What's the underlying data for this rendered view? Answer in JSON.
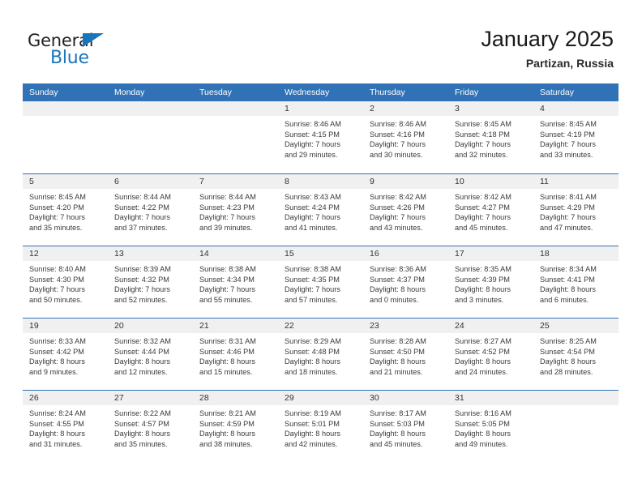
{
  "brand": {
    "name_dark": "General",
    "name_blue": "Blue",
    "triangle_icon": "triangle-icon",
    "accent_color": "#1b75bb"
  },
  "header": {
    "title": "January 2025",
    "subtitle": "Partizan, Russia"
  },
  "colors": {
    "header_blue": "#3072b5",
    "strip_gray": "#f0f0f0",
    "text": "#333333"
  },
  "calendar": {
    "weekday_headers": [
      "Sunday",
      "Monday",
      "Tuesday",
      "Wednesday",
      "Thursday",
      "Friday",
      "Saturday"
    ],
    "weeks": [
      [
        {
          "day": "",
          "lines": []
        },
        {
          "day": "",
          "lines": []
        },
        {
          "day": "",
          "lines": []
        },
        {
          "day": "1",
          "lines": [
            "Sunrise: 8:46 AM",
            "Sunset: 4:15 PM",
            "Daylight: 7 hours",
            "and 29 minutes."
          ]
        },
        {
          "day": "2",
          "lines": [
            "Sunrise: 8:46 AM",
            "Sunset: 4:16 PM",
            "Daylight: 7 hours",
            "and 30 minutes."
          ]
        },
        {
          "day": "3",
          "lines": [
            "Sunrise: 8:45 AM",
            "Sunset: 4:18 PM",
            "Daylight: 7 hours",
            "and 32 minutes."
          ]
        },
        {
          "day": "4",
          "lines": [
            "Sunrise: 8:45 AM",
            "Sunset: 4:19 PM",
            "Daylight: 7 hours",
            "and 33 minutes."
          ]
        }
      ],
      [
        {
          "day": "5",
          "lines": [
            "Sunrise: 8:45 AM",
            "Sunset: 4:20 PM",
            "Daylight: 7 hours",
            "and 35 minutes."
          ]
        },
        {
          "day": "6",
          "lines": [
            "Sunrise: 8:44 AM",
            "Sunset: 4:22 PM",
            "Daylight: 7 hours",
            "and 37 minutes."
          ]
        },
        {
          "day": "7",
          "lines": [
            "Sunrise: 8:44 AM",
            "Sunset: 4:23 PM",
            "Daylight: 7 hours",
            "and 39 minutes."
          ]
        },
        {
          "day": "8",
          "lines": [
            "Sunrise: 8:43 AM",
            "Sunset: 4:24 PM",
            "Daylight: 7 hours",
            "and 41 minutes."
          ]
        },
        {
          "day": "9",
          "lines": [
            "Sunrise: 8:42 AM",
            "Sunset: 4:26 PM",
            "Daylight: 7 hours",
            "and 43 minutes."
          ]
        },
        {
          "day": "10",
          "lines": [
            "Sunrise: 8:42 AM",
            "Sunset: 4:27 PM",
            "Daylight: 7 hours",
            "and 45 minutes."
          ]
        },
        {
          "day": "11",
          "lines": [
            "Sunrise: 8:41 AM",
            "Sunset: 4:29 PM",
            "Daylight: 7 hours",
            "and 47 minutes."
          ]
        }
      ],
      [
        {
          "day": "12",
          "lines": [
            "Sunrise: 8:40 AM",
            "Sunset: 4:30 PM",
            "Daylight: 7 hours",
            "and 50 minutes."
          ]
        },
        {
          "day": "13",
          "lines": [
            "Sunrise: 8:39 AM",
            "Sunset: 4:32 PM",
            "Daylight: 7 hours",
            "and 52 minutes."
          ]
        },
        {
          "day": "14",
          "lines": [
            "Sunrise: 8:38 AM",
            "Sunset: 4:34 PM",
            "Daylight: 7 hours",
            "and 55 minutes."
          ]
        },
        {
          "day": "15",
          "lines": [
            "Sunrise: 8:38 AM",
            "Sunset: 4:35 PM",
            "Daylight: 7 hours",
            "and 57 minutes."
          ]
        },
        {
          "day": "16",
          "lines": [
            "Sunrise: 8:36 AM",
            "Sunset: 4:37 PM",
            "Daylight: 8 hours",
            "and 0 minutes."
          ]
        },
        {
          "day": "17",
          "lines": [
            "Sunrise: 8:35 AM",
            "Sunset: 4:39 PM",
            "Daylight: 8 hours",
            "and 3 minutes."
          ]
        },
        {
          "day": "18",
          "lines": [
            "Sunrise: 8:34 AM",
            "Sunset: 4:41 PM",
            "Daylight: 8 hours",
            "and 6 minutes."
          ]
        }
      ],
      [
        {
          "day": "19",
          "lines": [
            "Sunrise: 8:33 AM",
            "Sunset: 4:42 PM",
            "Daylight: 8 hours",
            "and 9 minutes."
          ]
        },
        {
          "day": "20",
          "lines": [
            "Sunrise: 8:32 AM",
            "Sunset: 4:44 PM",
            "Daylight: 8 hours",
            "and 12 minutes."
          ]
        },
        {
          "day": "21",
          "lines": [
            "Sunrise: 8:31 AM",
            "Sunset: 4:46 PM",
            "Daylight: 8 hours",
            "and 15 minutes."
          ]
        },
        {
          "day": "22",
          "lines": [
            "Sunrise: 8:29 AM",
            "Sunset: 4:48 PM",
            "Daylight: 8 hours",
            "and 18 minutes."
          ]
        },
        {
          "day": "23",
          "lines": [
            "Sunrise: 8:28 AM",
            "Sunset: 4:50 PM",
            "Daylight: 8 hours",
            "and 21 minutes."
          ]
        },
        {
          "day": "24",
          "lines": [
            "Sunrise: 8:27 AM",
            "Sunset: 4:52 PM",
            "Daylight: 8 hours",
            "and 24 minutes."
          ]
        },
        {
          "day": "25",
          "lines": [
            "Sunrise: 8:25 AM",
            "Sunset: 4:54 PM",
            "Daylight: 8 hours",
            "and 28 minutes."
          ]
        }
      ],
      [
        {
          "day": "26",
          "lines": [
            "Sunrise: 8:24 AM",
            "Sunset: 4:55 PM",
            "Daylight: 8 hours",
            "and 31 minutes."
          ]
        },
        {
          "day": "27",
          "lines": [
            "Sunrise: 8:22 AM",
            "Sunset: 4:57 PM",
            "Daylight: 8 hours",
            "and 35 minutes."
          ]
        },
        {
          "day": "28",
          "lines": [
            "Sunrise: 8:21 AM",
            "Sunset: 4:59 PM",
            "Daylight: 8 hours",
            "and 38 minutes."
          ]
        },
        {
          "day": "29",
          "lines": [
            "Sunrise: 8:19 AM",
            "Sunset: 5:01 PM",
            "Daylight: 8 hours",
            "and 42 minutes."
          ]
        },
        {
          "day": "30",
          "lines": [
            "Sunrise: 8:17 AM",
            "Sunset: 5:03 PM",
            "Daylight: 8 hours",
            "and 45 minutes."
          ]
        },
        {
          "day": "31",
          "lines": [
            "Sunrise: 8:16 AM",
            "Sunset: 5:05 PM",
            "Daylight: 8 hours",
            "and 49 minutes."
          ]
        },
        {
          "day": "",
          "lines": []
        }
      ]
    ]
  }
}
